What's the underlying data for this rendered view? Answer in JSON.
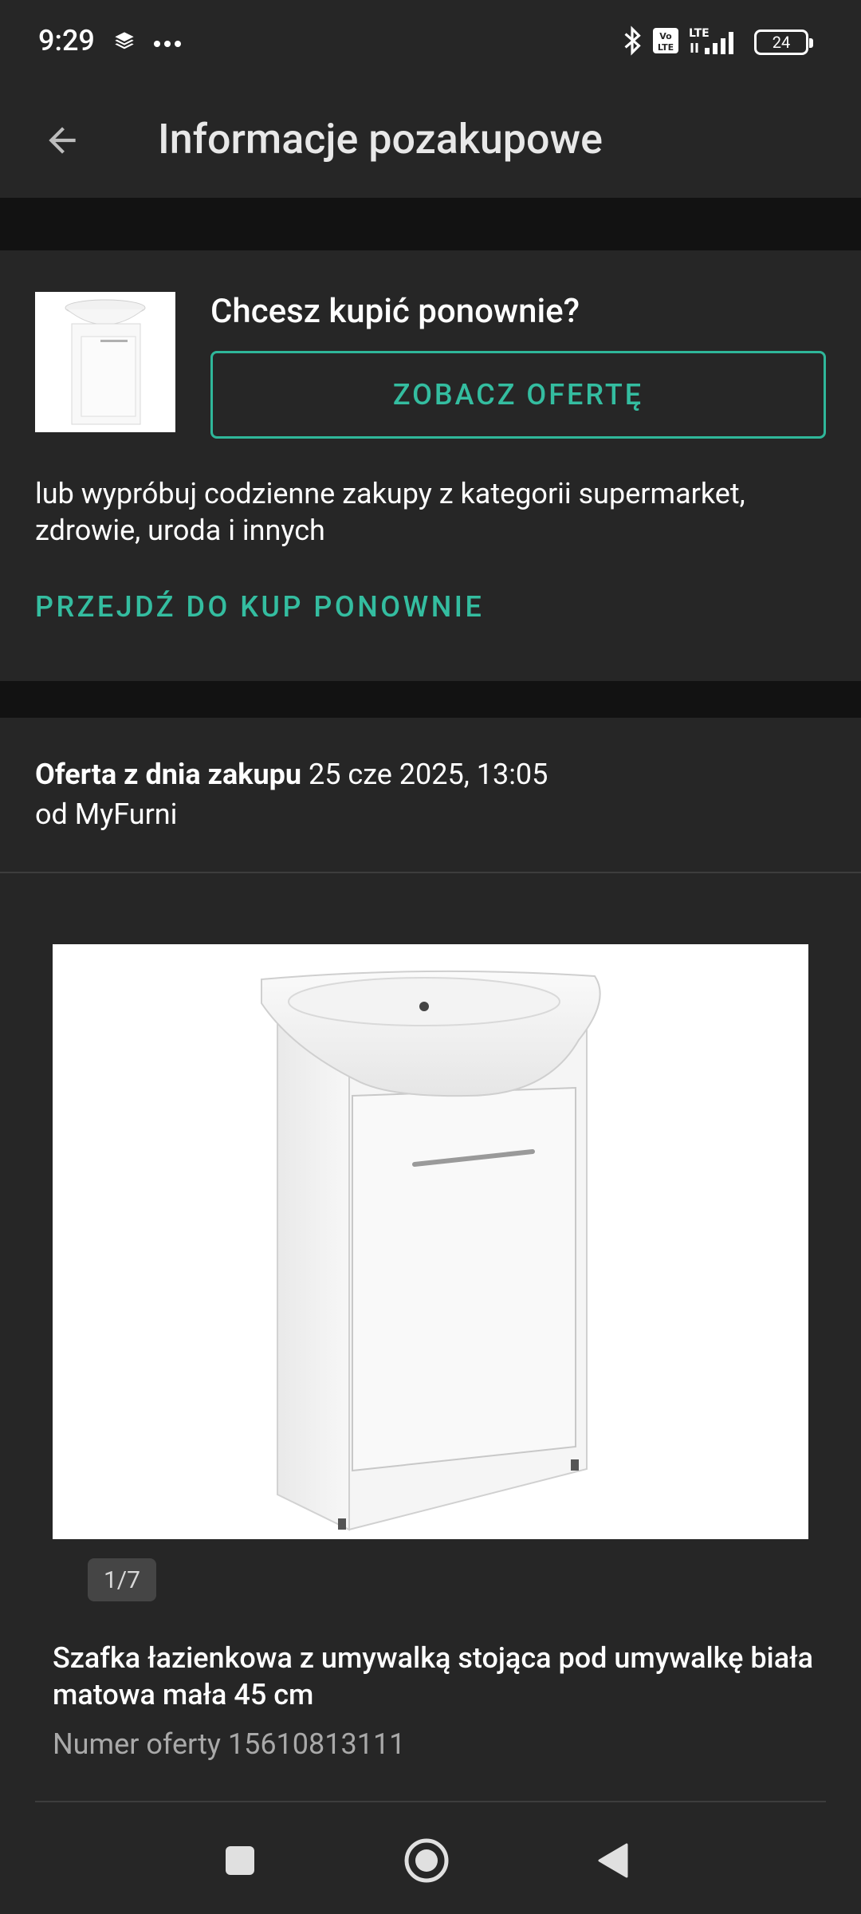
{
  "status_bar": {
    "time": "9:29",
    "battery": "24",
    "icons": [
      "layers-icon",
      "more-dots-icon",
      "bluetooth-icon",
      "volte-icon",
      "lte-signal-icon",
      "battery-icon"
    ]
  },
  "app_bar": {
    "title": "Informacje pozakupowe",
    "back_icon": "arrow-back-icon"
  },
  "buy_again": {
    "title": "Chcesz kupić ponownie?",
    "offer_button": "ZOBACZ OFERTĘ",
    "alt_text": "lub wypróbuj codzienne zakupy z kategorii supermarket, zdrowie, uroda i innych",
    "reorder_link": "PRZEJDŹ DO KUP PONOWNIE"
  },
  "offer_info": {
    "date_label": "Oferta z dnia zakupu",
    "date_value": "25 cze 2025, 13:05",
    "seller": "od MyFurni"
  },
  "product": {
    "image_counter": "1/7",
    "title": "Szafka łazienkowa z umywalką stojąca pod umywalkę biała matowa mała 45 cm",
    "offer_number": "Numer oferty 15610813111"
  },
  "colors": {
    "background": "#262626",
    "separator": "#121212",
    "accent": "#34bda0",
    "muted_text": "#a9a9a9"
  },
  "nav_bar": {
    "icons": [
      "recents-square-icon",
      "home-circle-icon",
      "back-triangle-icon"
    ]
  }
}
